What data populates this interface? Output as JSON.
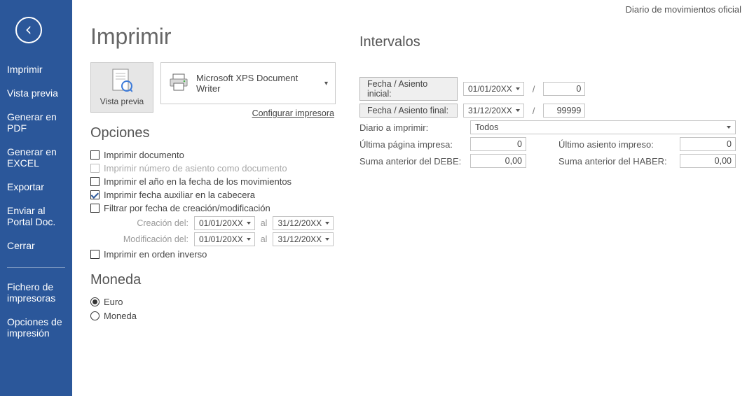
{
  "corner_title": "Diario de movimientos oficial",
  "sidebar": {
    "items": [
      "Imprimir",
      "Vista previa",
      "Generar en PDF",
      "Generar en EXCEL",
      "Exportar",
      "Enviar al Portal Doc.",
      "Cerrar"
    ],
    "footer_items": [
      "Fichero de impresoras",
      "Opciones de impresión"
    ]
  },
  "page_title": "Imprimir",
  "preview": {
    "label": "Vista previa"
  },
  "printer": {
    "name": "Microsoft XPS Document Writer",
    "config_link": "Configurar impresora"
  },
  "opciones": {
    "heading": "Opciones",
    "items": [
      {
        "label": "Imprimir documento",
        "checked": false,
        "disabled": false
      },
      {
        "label": "Imprimir número de asiento como documento",
        "checked": false,
        "disabled": true
      },
      {
        "label": "Imprimir el año en la fecha de los movimientos",
        "checked": false,
        "disabled": false
      },
      {
        "label": "Imprimir fecha auxiliar en la cabecera",
        "checked": true,
        "disabled": false
      },
      {
        "label": "Filtrar por fecha de creación/modificación",
        "checked": false,
        "disabled": false
      }
    ],
    "dates": {
      "row1": {
        "label": "Creación del:",
        "from": "01/01/20XX",
        "sep": "al",
        "to": "31/12/20XX"
      },
      "row2": {
        "label": "Modificación del:",
        "from": "01/01/20XX",
        "sep": "al",
        "to": "31/12/20XX"
      }
    },
    "item_inverse": {
      "label": "Imprimir en orden inverso",
      "checked": false
    }
  },
  "moneda": {
    "heading": "Moneda",
    "options": [
      {
        "label": "Euro",
        "checked": true
      },
      {
        "label": "Moneda",
        "checked": false
      }
    ]
  },
  "intervalos": {
    "heading": "Intervalos",
    "row_initial": {
      "button": "Fecha / Asiento inicial:",
      "date": "01/01/20XX",
      "sep": "/",
      "num": "0"
    },
    "row_final": {
      "button": "Fecha / Asiento final:",
      "date": "31/12/20XX",
      "sep": "/",
      "num": "99999"
    },
    "diario_label": "Diario a imprimir:",
    "diario_value": "Todos",
    "ultima_pagina_label": "Última página impresa:",
    "ultima_pagina_value": "0",
    "ultimo_asiento_label": "Último asiento impreso:",
    "ultimo_asiento_value": "0",
    "suma_debe_label": "Suma anterior del DEBE:",
    "suma_debe_value": "0,00",
    "suma_haber_label": "Suma anterior del HABER:",
    "suma_haber_value": "0,00"
  }
}
